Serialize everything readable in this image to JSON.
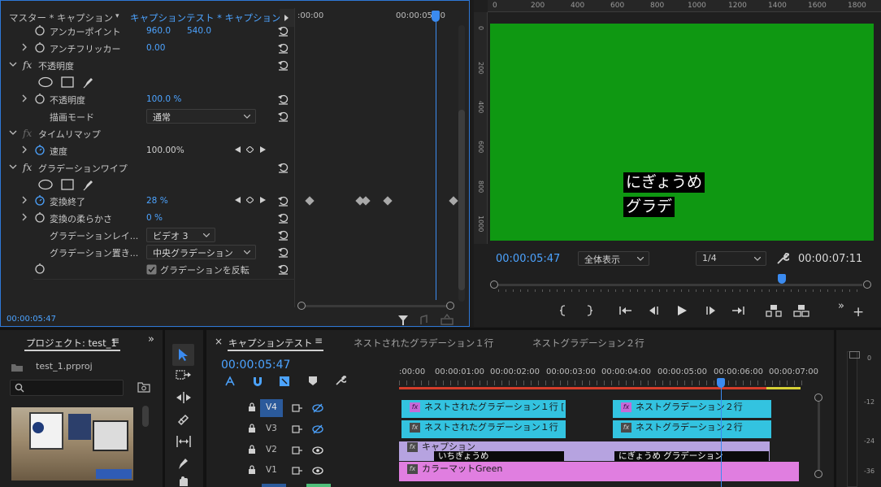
{
  "effect_controls": {
    "tab_master": "マスター * キャプション",
    "tab_sequence": "キャプションテスト * キャプション",
    "ruler_start": ":00:00",
    "ruler_end": "00:00:05:00",
    "anchor_point": {
      "label": "アンカーポイント",
      "x": "960.0",
      "y": "540.0"
    },
    "antiflicker": {
      "label": "アンチフリッカー",
      "value": "0.00"
    },
    "opacity_section": "不透明度",
    "opacity": {
      "label": "不透明度",
      "value": "100.0 %"
    },
    "blend_mode": {
      "label": "描画モード",
      "value": "通常"
    },
    "time_remap_section": "タイムリマップ",
    "speed": {
      "label": "速度",
      "value": "100.00%"
    },
    "gradient_wipe_section": "グラデーションワイプ",
    "transition_completion": {
      "label": "変換終了",
      "value": "28 %"
    },
    "transition_softness": {
      "label": "変換の柔らかさ",
      "value": "0 %"
    },
    "gradient_layer": {
      "label": "グラデーションレイ...",
      "value": "ビデオ 3"
    },
    "gradient_placement": {
      "label": "グラデーション置き...",
      "value": "中央グラデーション"
    },
    "invert_gradient": {
      "label": "グラデーションを反転",
      "checked": true
    },
    "timecode": "00:00:05:47"
  },
  "program_monitor": {
    "ruler_labels": [
      "0",
      "200",
      "400",
      "600",
      "800",
      "1000",
      "1200",
      "1400",
      "1600",
      "1800"
    ],
    "vruler_labels": [
      "0",
      "200",
      "400",
      "600",
      "800",
      "1000"
    ],
    "caption_line1": "にぎょうめ",
    "caption_line2": "グラデ",
    "video_color": "#0f9812",
    "current_timecode": "00:00:05:47",
    "zoom": "全体表示",
    "resolution": "1/4",
    "duration": "00:00:07:11",
    "playhead_fraction": 0.78
  },
  "project": {
    "title": "プロジェクト: test_1",
    "file": "test_1.prproj",
    "search_placeholder": ""
  },
  "timeline": {
    "tabs": [
      "キャプションテスト",
      "ネストされたグラデーション１行",
      "ネストグラデーション２行"
    ],
    "timecode": "00:00:05:47",
    "ruler_labels": [
      ":00:00",
      "00:00:01:00",
      "00:00:02:00",
      "00:00:03:00",
      "00:00:04:00",
      "00:00:05:00",
      "00:00:06:00",
      "00:00:07:00"
    ],
    "tracks": [
      "V4",
      "V3",
      "V2",
      "V1"
    ],
    "clips": {
      "v4a": "ネストされたグラデーション１行 [",
      "v4b": "ネストグラデーション２行",
      "v3a": "ネストされたグラデーション１行",
      "v3b": "ネストグラデーション２行",
      "v2a": "キャプション",
      "v2sub1": "いちぎょうめ",
      "v2sub2": "にぎょうめ グラデーション",
      "v1": "カラーマットGreen"
    },
    "meter_labels": [
      "0",
      "-12",
      "-24",
      "-36"
    ]
  },
  "colors": {
    "accent": "#2e78d6",
    "timecode_blue": "#4ca3ff",
    "nested_clip": "#33c3e0",
    "caption_clip": "#b6a3e0",
    "color_matte_clip": "#e07ee0"
  }
}
